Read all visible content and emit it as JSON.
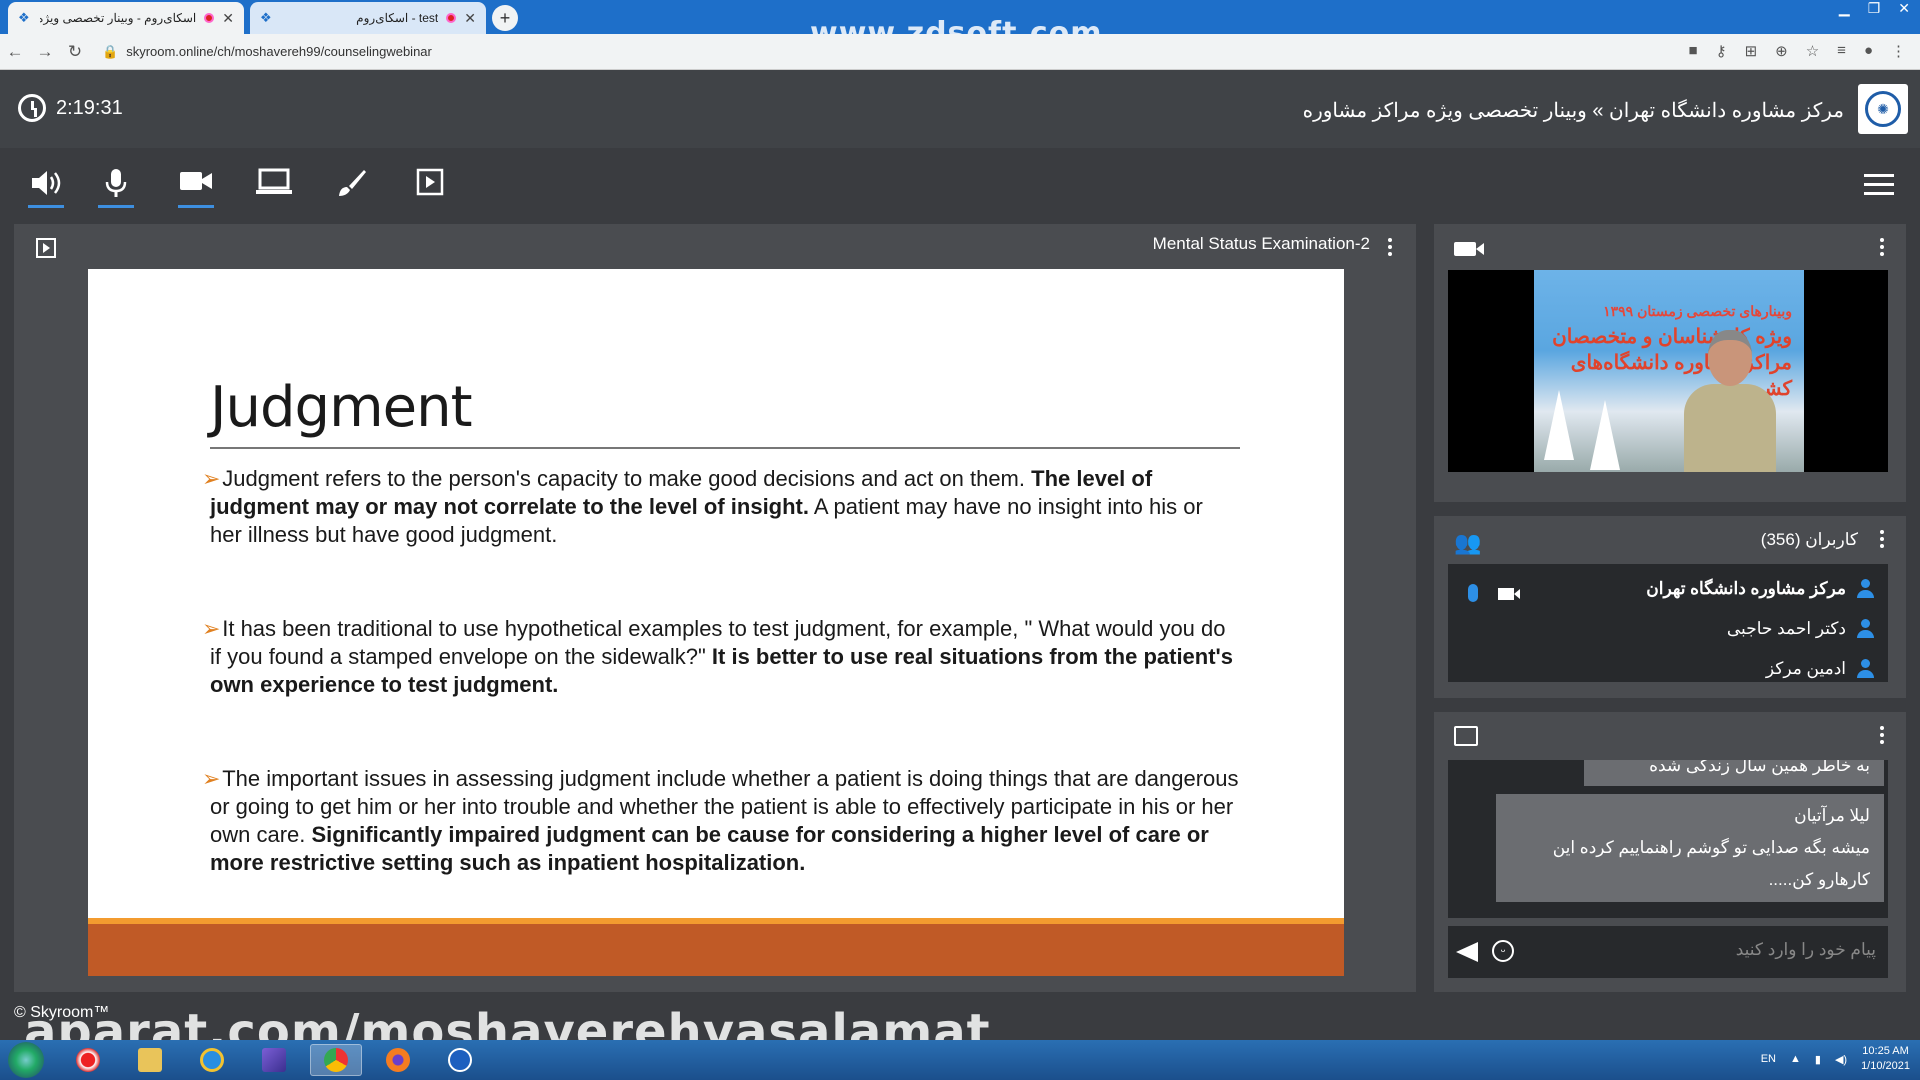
{
  "browser": {
    "tabs": [
      {
        "title": "اسکای‌روم - وبینار تخصصی ویژه مر",
        "active": true
      },
      {
        "title": "test - اسکای‌روم",
        "active": false
      }
    ],
    "new_tab": "+",
    "url": "skyroom.online/ch/moshavereh99/counselingwebinar",
    "watermark": "www.zdsoft.com"
  },
  "header": {
    "elapsed_time": "2:19:31",
    "title": "مرکز مشاوره دانشگاه تهران » وبینار تخصصی ویژه مراکز مشاوره"
  },
  "toolbar": {
    "tools": [
      "speaker-icon",
      "microphone-icon",
      "camera-icon",
      "screen-share-icon",
      "whiteboard-brush-icon",
      "presentation-icon"
    ]
  },
  "presentation": {
    "file_name": "Mental Status Examination-2",
    "slide": {
      "title": "Judgment",
      "bullets": [
        {
          "text": "Judgment refers to the person's capacity to make good decisions and act on them. ",
          "bold": "The level of judgment may or may not correlate to the level of insight.",
          "tail": " A patient may have no insight into his or her illness but have good judgment."
        },
        {
          "text": "It has been traditional to use hypothetical examples to test judgment, for example, \" What would you do if you found a stamped envelope on the sidewalk?\" ",
          "bold": "It is better to use real situations from the patient's own experience to test judgment.",
          "tail": ""
        },
        {
          "text": "The important issues in assessing judgment include whether a patient is doing things that are dangerous or going to get him or her into trouble and whether the patient is able to effectively participate in his or her own care. ",
          "bold": "Significantly impaired judgment can be cause for considering a higher level of care or more restrictive setting such as inpatient hospitalization.",
          "tail": ""
        }
      ]
    }
  },
  "video": {
    "banner_line1": "وبینارهای تخصصی زمستان ۱۳۹۹",
    "banner_line2": "ویژه کارشناسان و متخصصان",
    "banner_line3": "مراکز مشاوره دانشگاه‌های کشور"
  },
  "users": {
    "title": "کاربران (356)",
    "list": [
      {
        "name": "مرکز مشاوره دانشگاه تهران",
        "bold": true
      },
      {
        "name": "دکتر احمد حاجبی",
        "bold": false
      },
      {
        "name": "ادمین مرکز",
        "bold": false
      }
    ]
  },
  "chat": {
    "messages": [
      {
        "text": "به خاطر همین  سال زندگی شده"
      },
      {
        "author": "لیلا مرآتیان",
        "text": "میشه بگه  صدایی تو گوشم  راهنماییم کرده این کارهارو کن....."
      }
    ],
    "placeholder": "پیام خود را وارد کنید"
  },
  "footer": {
    "copyright": "© Skyroom™",
    "watermark": "aparat.com/moshaverehvasalamat"
  },
  "taskbar": {
    "language": "EN",
    "time": "10:25 AM",
    "date": "1/10/2021"
  }
}
